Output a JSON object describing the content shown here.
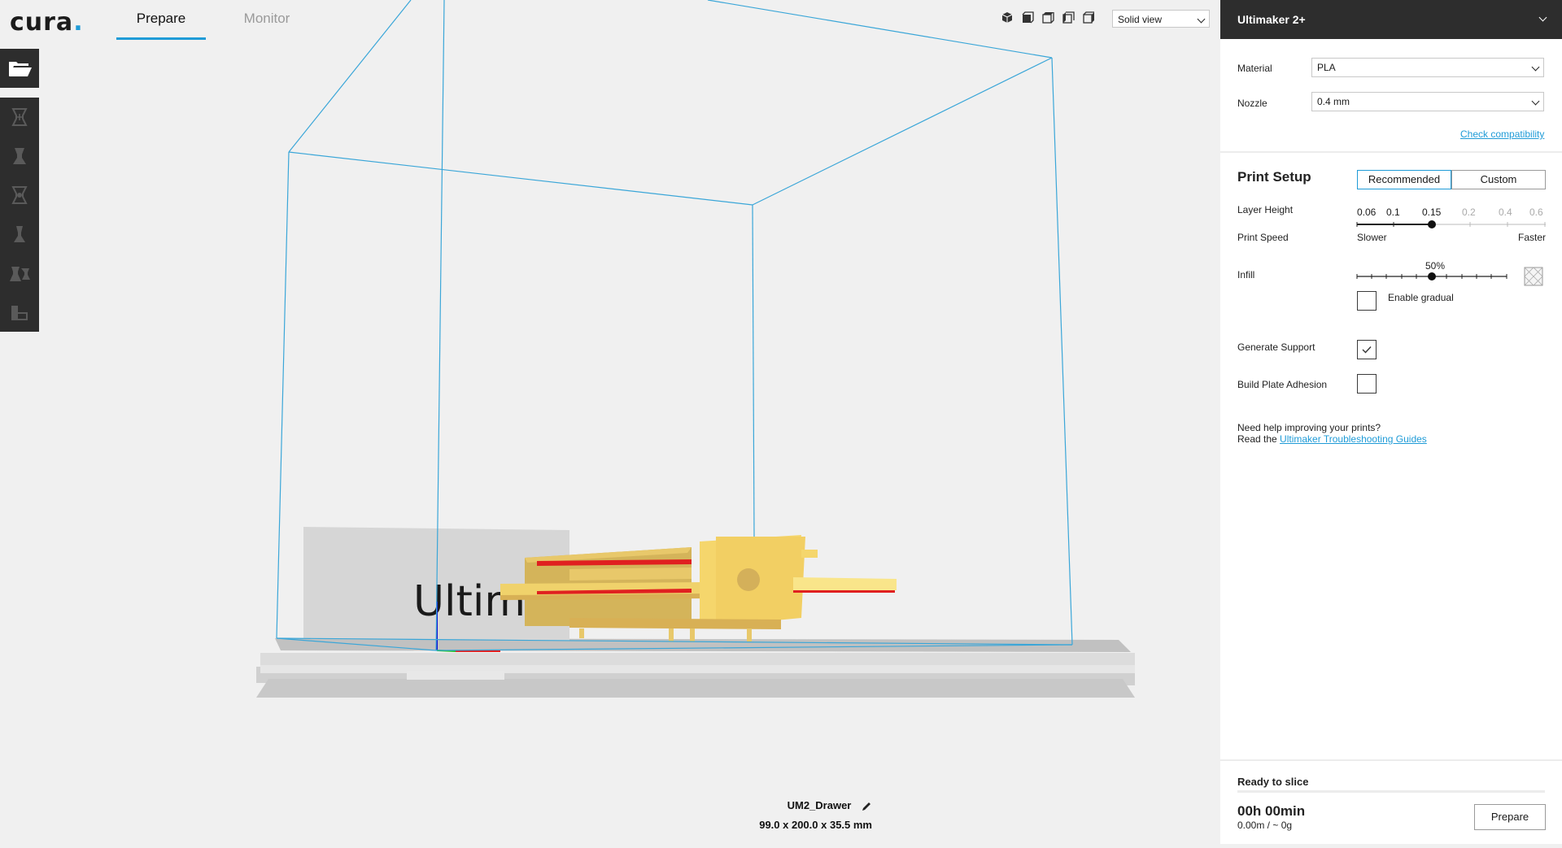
{
  "app": {
    "logo": "cura",
    "logo_dot": ".",
    "tabs": [
      {
        "label": "Prepare",
        "active": true
      },
      {
        "label": "Monitor",
        "active": false
      }
    ],
    "view_mode": "Solid view"
  },
  "left_toolbar": {
    "open_icon": "folder-open-icon",
    "tools": [
      "move-icon",
      "scale-icon",
      "rotate-icon",
      "mirror-icon",
      "per-model-settings-icon",
      "support-blocker-icon"
    ]
  },
  "scene": {
    "model_name": "UM2_Drawer",
    "dimensions": "99.0 x 200.0 x 35.5 mm",
    "plate_text": "Ultima"
  },
  "printer": {
    "name": "Ultimaker 2+",
    "material_label": "Material",
    "material_value": "PLA",
    "nozzle_label": "Nozzle",
    "nozzle_value": "0.4 mm",
    "check_link": "Check compatibility"
  },
  "print_setup": {
    "title": "Print Setup",
    "mode_recommended": "Recommended",
    "mode_custom": "Custom",
    "layer_height_label": "Layer Height",
    "layer_heights": [
      "0.06",
      "0.1",
      "0.15",
      "0.2",
      "0.4",
      "0.6"
    ],
    "layer_height_selected": "0.15",
    "print_speed_label": "Print Speed",
    "slower": "Slower",
    "faster": "Faster",
    "infill_label": "Infill",
    "infill_value": "50%",
    "infill_fraction": 0.5,
    "enable_gradual": "Enable gradual",
    "enable_gradual_checked": false,
    "generate_support": "Generate Support",
    "generate_support_checked": true,
    "build_plate_adhesion": "Build Plate Adhesion",
    "build_plate_adhesion_checked": false,
    "help_line1": "Need help improving your prints?",
    "help_prefix": "Read the",
    "help_link": "Ultimaker Troubleshooting Guides"
  },
  "slice": {
    "status": "Ready to slice",
    "time": "00h 00min",
    "material_usage": "0.00m / ~ 0g",
    "button": "Prepare"
  },
  "colors": {
    "accent": "#1f9bd7",
    "toolbar_dark": "#2d2d2d",
    "model_yellow": "#f5d66c",
    "overhang_red": "#e02020"
  }
}
